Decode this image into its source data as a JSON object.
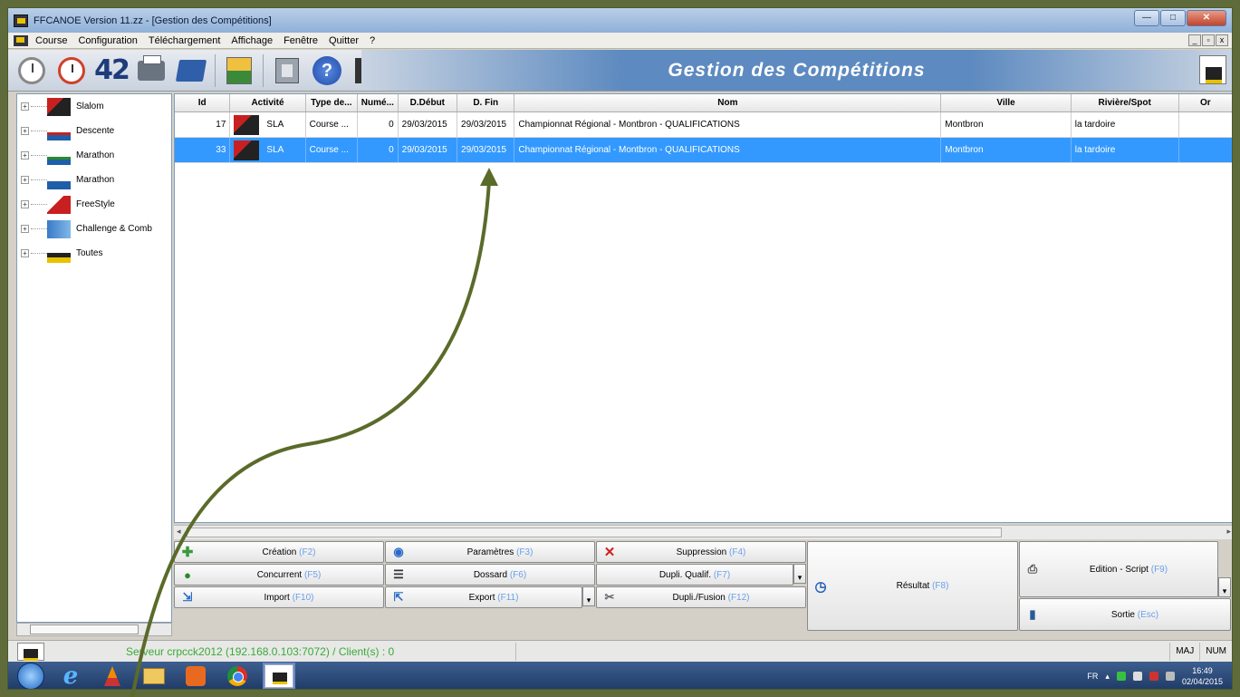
{
  "window": {
    "title": "FFCANOE Version 11.zz - [Gestion des Compétitions]"
  },
  "menu": [
    "Course",
    "Configuration",
    "Téléchargement",
    "Affichage",
    "Fenêtre",
    "Quitter",
    "?"
  ],
  "toolbar": {
    "counter_label": "42",
    "banner": "Gestion des Compétitions"
  },
  "tree": [
    {
      "label": "Slalom",
      "icon": "slalom-icon"
    },
    {
      "label": "Descente",
      "icon": "descente-icon"
    },
    {
      "label": "Marathon",
      "icon": "marathon-icon"
    },
    {
      "label": "Marathon",
      "icon": "marathon-icon"
    },
    {
      "label": "FreeStyle",
      "icon": "freestyle-icon"
    },
    {
      "label": "Challenge & Comb",
      "icon": "challenge-icon"
    },
    {
      "label": "Toutes",
      "icon": "toutes-icon"
    }
  ],
  "grid": {
    "columns": [
      "Id",
      "Activité",
      "Type de...",
      "Numé...",
      "D.Début",
      "D. Fin",
      "Nom",
      "Ville",
      "Rivière/Spot",
      "Or"
    ],
    "rows": [
      {
        "id": "17",
        "activite": "SLA",
        "type": "Course ...",
        "numero": "0",
        "debut": "29/03/2015",
        "fin": "29/03/2015",
        "nom": "Championnat Régional - Montbron - QUALIFICATIONS",
        "ville": "Montbron",
        "riviere": "la tardoire",
        "selected": false
      },
      {
        "id": "33",
        "activite": "SLA",
        "type": "Course ...",
        "numero": "0",
        "debut": "29/03/2015",
        "fin": "29/03/2015",
        "nom": "Championnat Régional - Montbron - QUALIFICATIONS",
        "ville": "Montbron",
        "riviere": "la tardoire",
        "selected": true
      }
    ]
  },
  "buttons": {
    "creation": {
      "label": "Création",
      "key": "(F2)"
    },
    "parametres": {
      "label": "Paramètres",
      "key": "(F3)"
    },
    "suppression": {
      "label": "Suppression",
      "key": "(F4)"
    },
    "concurrent": {
      "label": "Concurrent",
      "key": "(F5)"
    },
    "dossard": {
      "label": "Dossard",
      "key": "(F6)"
    },
    "dupli_qualif": {
      "label": "Dupli. Qualif.",
      "key": "(F7)"
    },
    "resultat": {
      "label": "Résultat",
      "key": "(F8)"
    },
    "edition": {
      "label": "Edition - Script",
      "key": "(F9)"
    },
    "import": {
      "label": "Import",
      "key": "(F10)"
    },
    "export": {
      "label": "Export",
      "key": "(F11)"
    },
    "dupli_fusion": {
      "label": "Dupli./Fusion",
      "key": "(F12)"
    },
    "sortie": {
      "label": "Sortie",
      "key": "(Esc)"
    }
  },
  "status": {
    "server": "Serveur crpcck2012 (192.168.0.103:7072) / Client(s) : 0",
    "maj": "MAJ",
    "num": "NUM"
  },
  "taskbar": {
    "lang": "FR",
    "time": "16:49",
    "date": "02/04/2015"
  },
  "colors": {
    "selection": "#3399ff",
    "banner": "#5d8ac0",
    "arrow": "#5a6b2a",
    "server_text": "#3aaa3a"
  }
}
